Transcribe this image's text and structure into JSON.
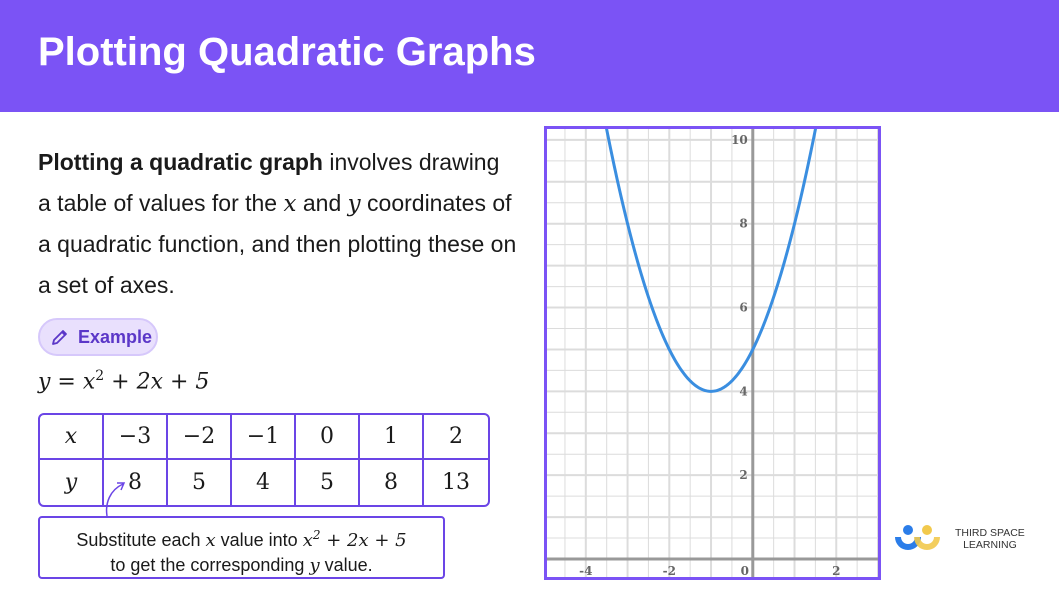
{
  "header": {
    "title": "Plotting Quadratic Graphs"
  },
  "intro": {
    "bold": "Plotting a quadratic graph",
    "t1": " involves drawing a table of values for the ",
    "x": "x",
    "t2": " and ",
    "y": "y",
    "t3": " coordinates of a quadratic function, and then plotting these on a set of axes."
  },
  "example": {
    "label": "Example",
    "icon": "pencil-icon"
  },
  "equation": {
    "lhs": "y = x",
    "exp": "2",
    "rhs": " + 2x + 5"
  },
  "table": {
    "header_x": "x",
    "header_y": "y",
    "x": [
      "−3",
      "−2",
      "−1",
      "0",
      "1",
      "2"
    ],
    "y": [
      "8",
      "5",
      "4",
      "5",
      "8",
      "13"
    ]
  },
  "note": {
    "a": "Substitute each ",
    "x": "x",
    "b": " value into ",
    "expr": "x",
    "exp": "2",
    "c": " + 2x + 5",
    "d": "to get the corresponding ",
    "y": "y",
    "e": " value."
  },
  "chart_data": {
    "type": "line",
    "function": "y = x^2 + 2x + 5",
    "xlim": [
      -4.93,
      3.0
    ],
    "ylim": [
      -0.43,
      10.26
    ],
    "grid": true,
    "minor_grid_step": 0.5,
    "x_ticks": [
      "-4",
      "-2",
      "0",
      "2"
    ],
    "y_ticks": [
      "2",
      "4",
      "6",
      "8",
      "10"
    ],
    "x_tick_values": [
      -4,
      -2,
      0,
      2
    ],
    "y_tick_values": [
      2,
      4,
      6,
      8,
      10
    ],
    "curve_color": "#3a8ee0"
  },
  "logo": {
    "line1": "THIRD SPACE",
    "line2": "LEARNING"
  },
  "colors": {
    "brand": "#7b53f5",
    "curve": "#3a8ee0"
  }
}
